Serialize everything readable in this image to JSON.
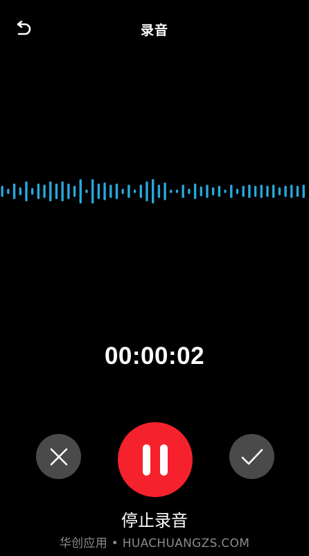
{
  "header": {
    "title": "录音",
    "back_icon": "undo-arrow-icon"
  },
  "waveform": {
    "color": "#29a8dc",
    "levels": [
      0.25,
      0.12,
      0.35,
      0.18,
      0.45,
      0.15,
      0.35,
      0.3,
      0.45,
      0.35,
      0.45,
      0.35,
      0.25,
      0.55,
      0.08,
      0.55,
      0.35,
      0.4,
      0.3,
      0.35,
      0.12,
      0.3,
      0.08,
      0.3,
      0.45,
      0.55,
      0.3,
      0.4,
      0.06,
      0.06,
      0.3,
      0.12,
      0.35,
      0.22,
      0.3,
      0.18,
      0.25,
      0.06,
      0.3,
      0.12,
      0.25,
      0.3,
      0.25,
      0.3,
      0.25,
      0.3,
      0.18,
      0.25,
      0.3,
      0.25,
      0.3
    ]
  },
  "timer": {
    "value": "00:00:02"
  },
  "controls": {
    "cancel_icon": "close-icon",
    "pause_icon": "pause-icon",
    "confirm_icon": "checkmark-icon",
    "cancel_color": "#4a4a4a",
    "pause_color": "#f5222d",
    "confirm_color": "#4a4a4a",
    "status_label": "停止录音"
  },
  "watermark": {
    "text": "华创应用 • HUACHUANGZS.COM"
  }
}
